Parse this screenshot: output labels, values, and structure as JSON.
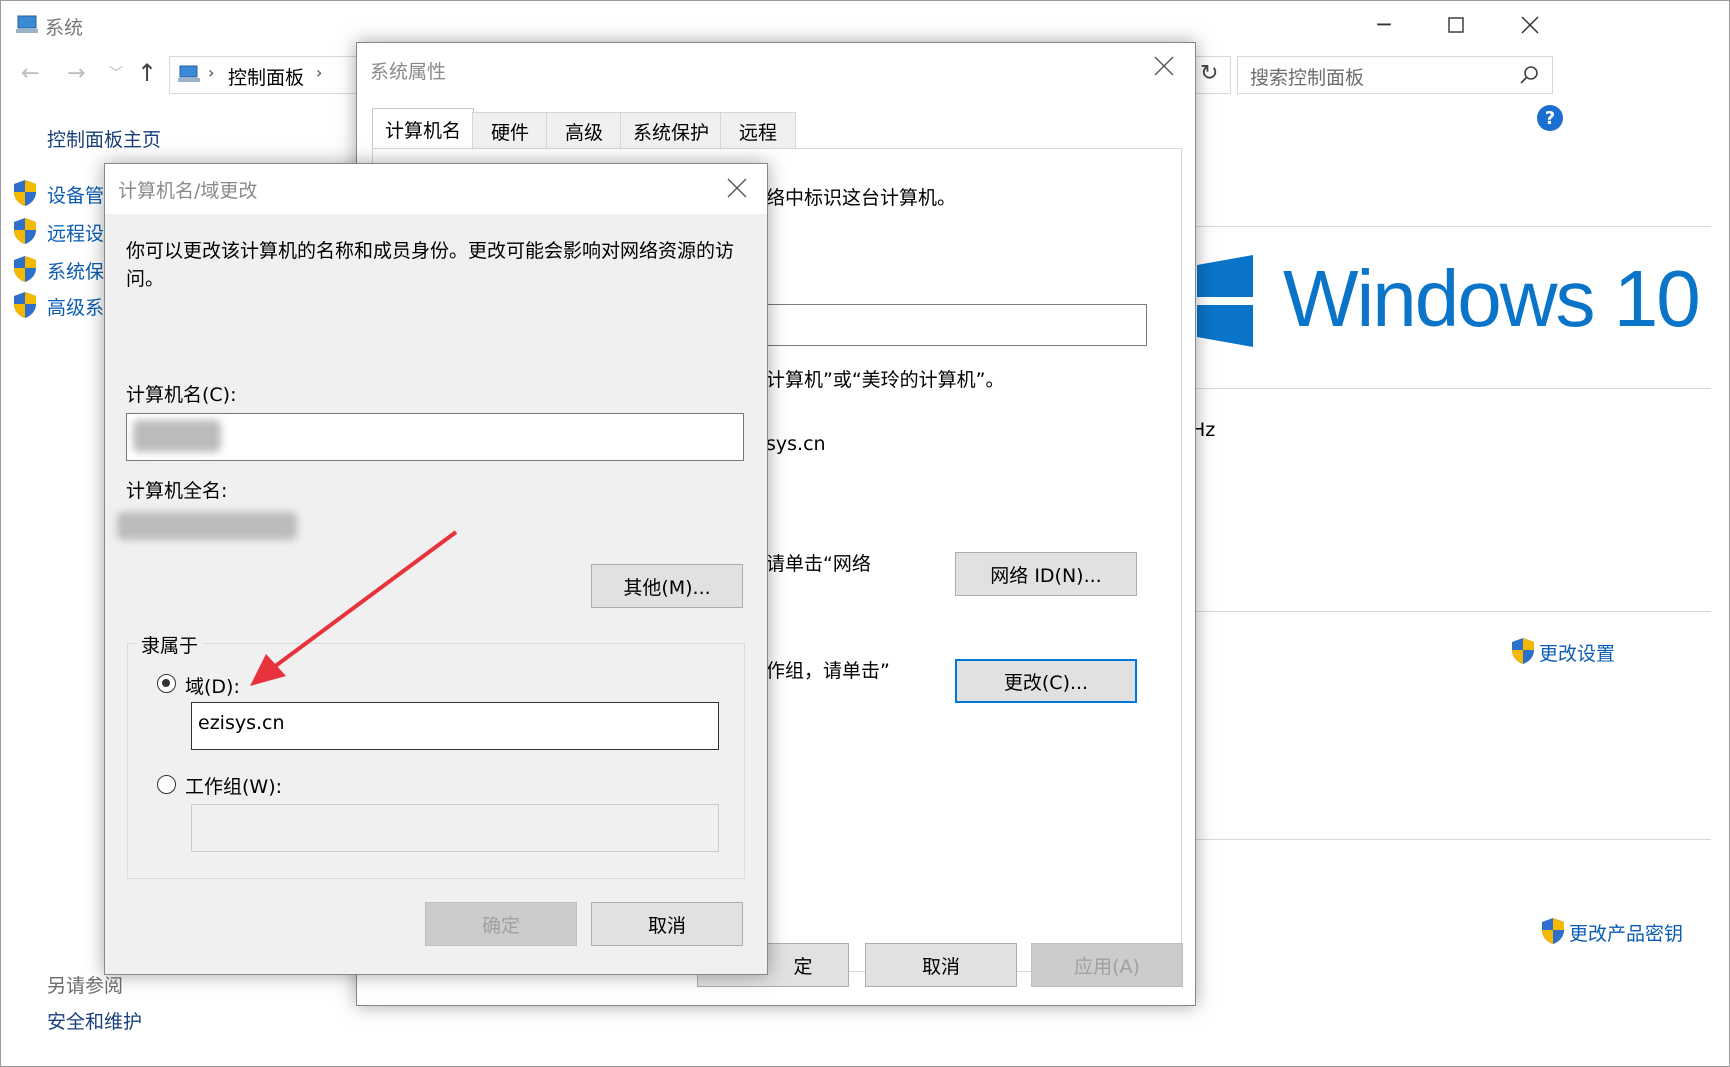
{
  "main_window": {
    "title": "系统",
    "breadcrumb_item": "控制面板",
    "search_placeholder": "搜索控制面板",
    "help_label": "?",
    "sidebar": {
      "home_link": "控制面板主页",
      "items": [
        "设备管",
        "远程设",
        "系统保",
        "高级系"
      ],
      "see_also_label": "另请参阅",
      "see_also_link": "安全和维护"
    },
    "windows_logo_text": "Windows 10",
    "partial_hz": "Hz",
    "change_settings_link": "更改设置",
    "change_product_key_link": "更改产品密钥"
  },
  "system_properties": {
    "title": "系统属性",
    "tabs": [
      "计算机名",
      "硬件",
      "高级",
      "系统保护",
      "远程"
    ],
    "text_identify": "络中标识这台计算机。",
    "text_example": "计算机”或“美玲的计算机”。",
    "domain_partial": "sys.cn",
    "text_network_click": "请单击“网络",
    "network_id_button": "网络 ID(N)...",
    "text_workgroup_click": "作组，请单击”",
    "change_button": "更改(C)...",
    "ok_button": "确定",
    "ok_button_partial": "定",
    "cancel_button": "取消",
    "apply_button": "应用(A)"
  },
  "rename_dialog": {
    "title": "计算机名/域更改",
    "description": "你可以更改该计算机的名称和成员身份。更改可能会影响对网络资源的访问。",
    "computer_name_label": "计算机名(C):",
    "full_name_label": "计算机全名:",
    "more_button": "其他(M)...",
    "member_of_label": "隶属于",
    "domain_label": "域(D):",
    "domain_value": "ezisys.cn",
    "workgroup_label": "工作组(W):",
    "workgroup_value": "",
    "ok_button": "确定",
    "cancel_button": "取消"
  },
  "colors": {
    "link": "#0a5cb5",
    "windows_blue": "#0a74c9",
    "annotation_arrow": "#e8323c",
    "focus_border": "#0078d7"
  }
}
